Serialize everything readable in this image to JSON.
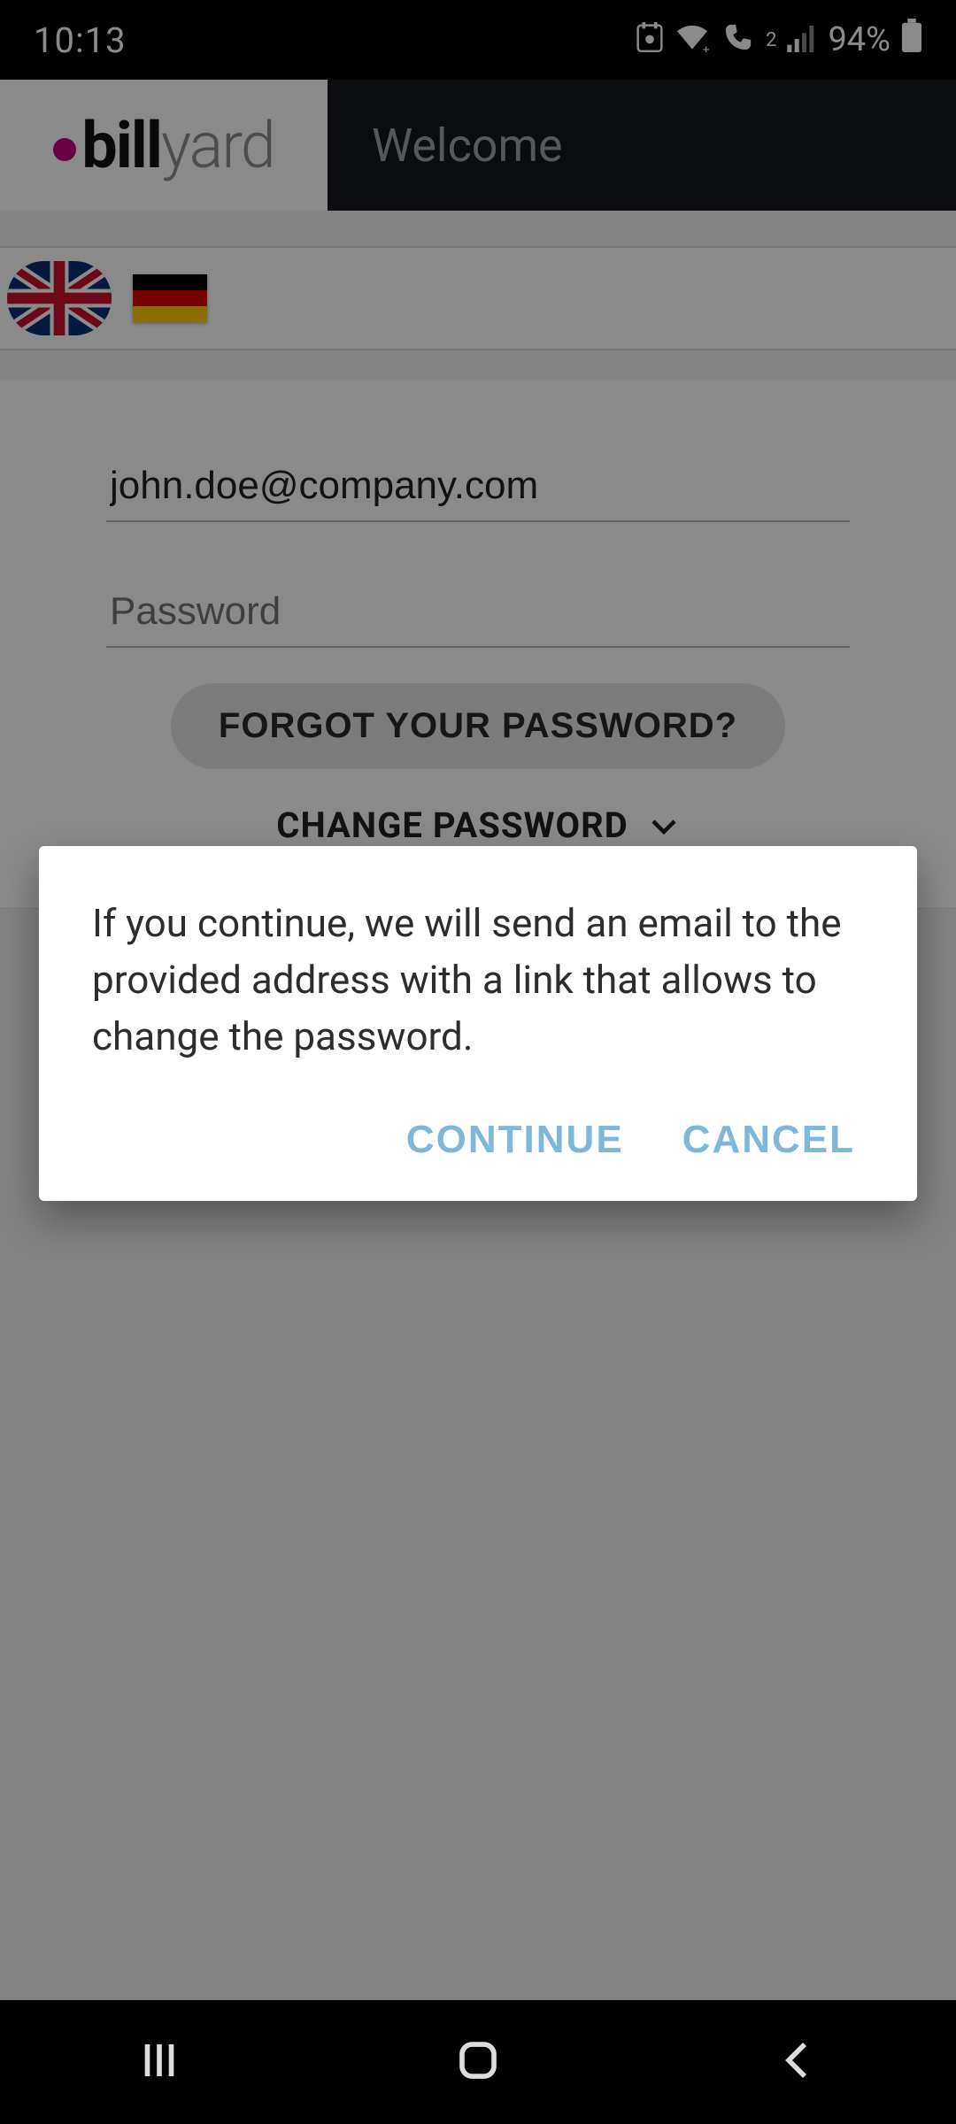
{
  "status": {
    "time": "10:13",
    "battery_pct": "94%"
  },
  "appbar": {
    "logo_primary": "bill",
    "logo_secondary": "yard",
    "title": "Welcome"
  },
  "languages": {
    "uk": "english-uk",
    "de": "german"
  },
  "login": {
    "email_value": "john.doe@company.com",
    "password_placeholder": "Password",
    "forgot_label": "FORGOT YOUR PASSWORD?",
    "change_label": "CHANGE PASSWORD"
  },
  "dialog": {
    "message": "If you continue, we will send an email to the provided address with a link that allows to change the password.",
    "continue_label": "CONTINUE",
    "cancel_label": "CANCEL"
  }
}
